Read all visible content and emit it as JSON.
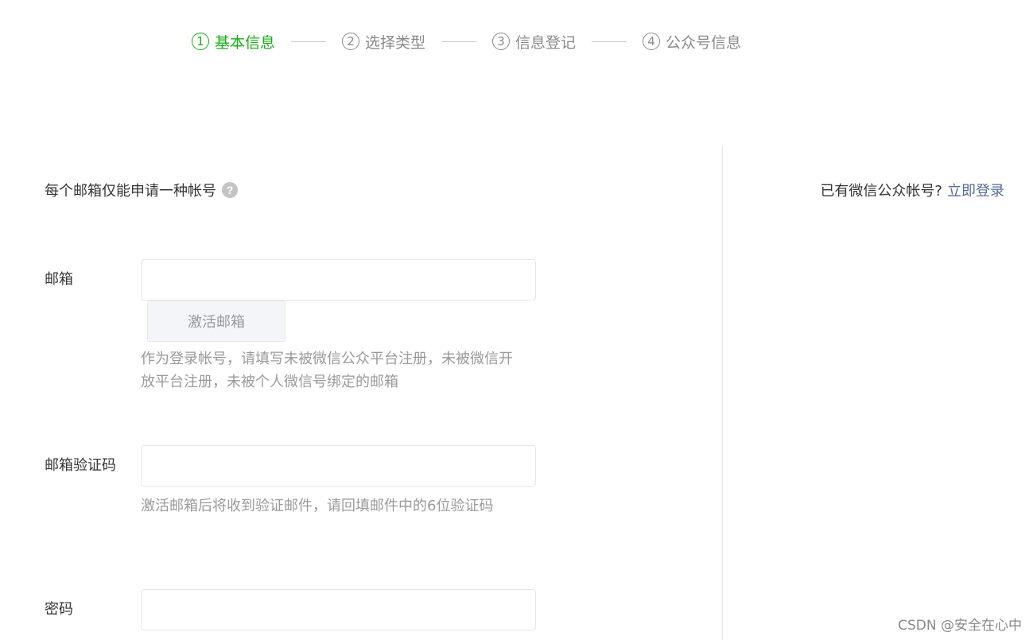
{
  "stepper": {
    "steps": [
      {
        "number": "1",
        "label": "基本信息",
        "active": true
      },
      {
        "number": "2",
        "label": "选择类型",
        "active": false
      },
      {
        "number": "3",
        "label": "信息登记",
        "active": false
      },
      {
        "number": "4",
        "label": "公众号信息",
        "active": false
      }
    ]
  },
  "notice": {
    "text": "每个邮箱仅能申请一种帐号",
    "help_icon": "question-icon",
    "help_glyph": "?"
  },
  "form": {
    "email": {
      "label": "邮箱",
      "value": "",
      "placeholder": "",
      "activate_button": "激活邮箱",
      "hint": "作为登录帐号，请填写未被微信公众平台注册，未被微信开放平台注册，未被个人微信号绑定的邮箱"
    },
    "code": {
      "label": "邮箱验证码",
      "value": "",
      "placeholder": "",
      "hint": "激活邮箱后将收到验证邮件，请回填邮件中的6位验证码"
    },
    "password": {
      "label": "密码",
      "value": "",
      "placeholder": ""
    }
  },
  "sidebar": {
    "prompt": "已有微信公众帐号?",
    "login_link": "立即登录"
  },
  "watermark": "CSDN @安全在心中",
  "colors": {
    "accent_green": "#1aad19",
    "link_blue": "#576b95",
    "muted_text": "#9a9a9a",
    "border": "#e7e7eb"
  }
}
